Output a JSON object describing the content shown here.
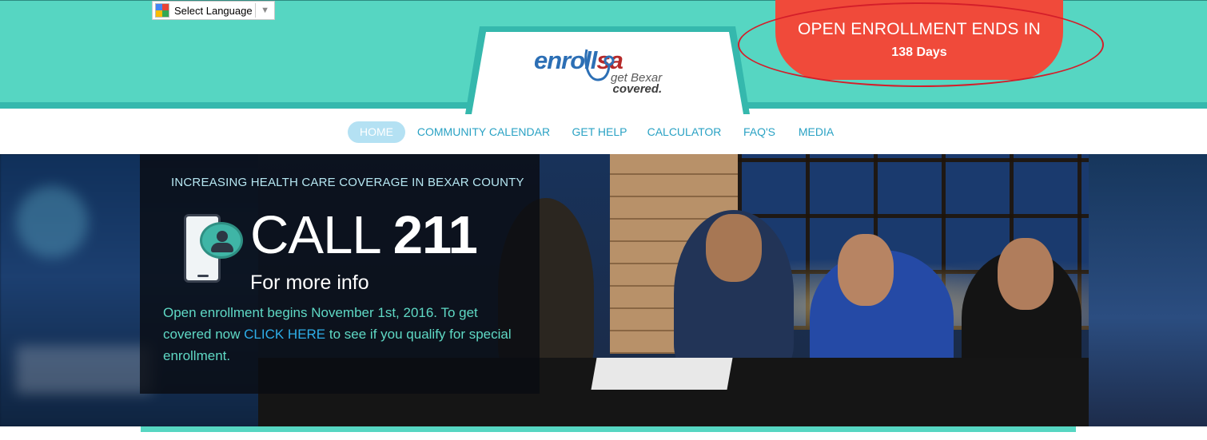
{
  "translate": {
    "label": "Select Language",
    "caret": "▼"
  },
  "logo": {
    "word_en": "enro",
    "word_mid": "ll",
    "word_sa": "sa",
    "tagline_1": "get Bexar",
    "tagline_2": "covered."
  },
  "countdown": {
    "title": "OPEN ENROLLMENT ENDS IN",
    "days": "138 Days"
  },
  "nav": {
    "items": [
      {
        "label": "HOME",
        "active": true
      },
      {
        "label": "COMMUNITY CALENDAR"
      },
      {
        "label": "GET HELP"
      },
      {
        "label": "CALCULATOR"
      },
      {
        "label": "FAQ'S"
      },
      {
        "label": "MEDIA"
      }
    ]
  },
  "hero": {
    "tagline": "INCREASING HEALTH CARE COVERAGE IN BEXAR COUNTY",
    "call_word": "CALL",
    "call_number": "211",
    "more_info": "For more info",
    "body_1": "Open enrollment begins November 1st, 2016. To get covered now",
    "link": "CLICK HERE",
    "body_2": "to see if you qualify for special enrollment."
  },
  "colors": {
    "teal": "#56d6c2",
    "teal_dark": "#35b8ad",
    "countdown_red": "#f04a3a",
    "nav_text": "#2aa2c4",
    "nav_active_bg": "#b4e1f3",
    "body_text": "#5fd9c5",
    "link": "#2eaee8"
  }
}
